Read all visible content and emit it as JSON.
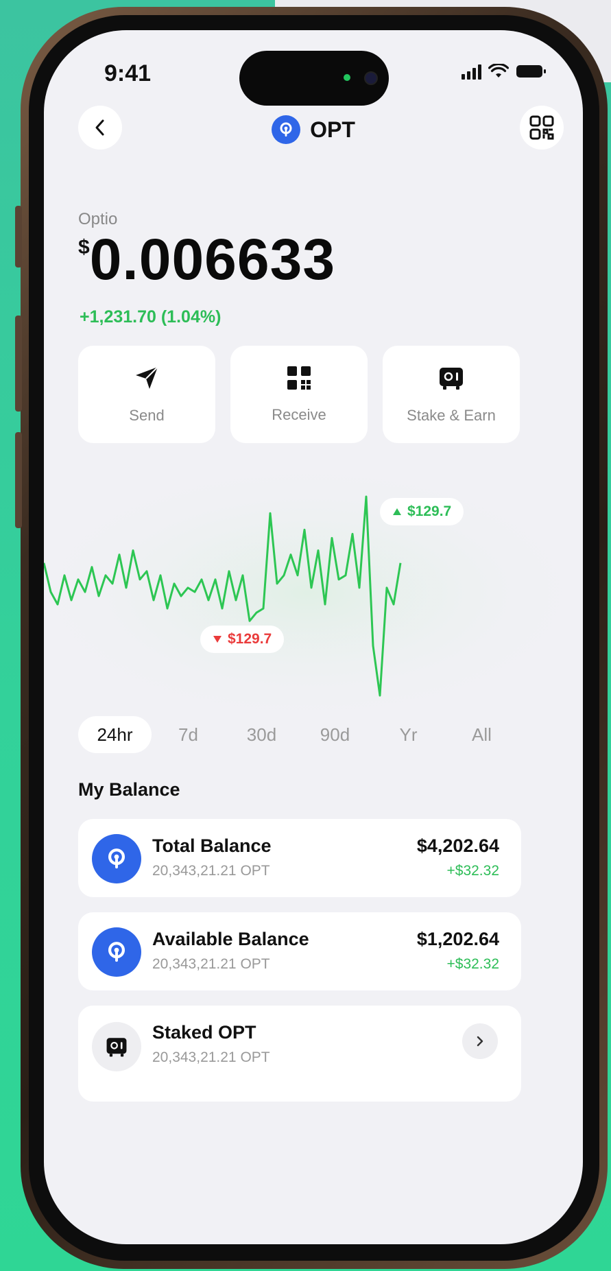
{
  "status_bar": {
    "time": "9:41"
  },
  "header": {
    "title": "OPT"
  },
  "token": {
    "name": "Optio",
    "currency_symbol": "$",
    "price": "0.006633",
    "change": "+1,231.70 (1.04%)"
  },
  "actions": [
    {
      "label": "Send",
      "icon": "send-icon"
    },
    {
      "label": "Receive",
      "icon": "qr-icon"
    },
    {
      "label": "Stake & Earn",
      "icon": "vault-icon"
    }
  ],
  "chart_data": {
    "type": "line",
    "title": "",
    "xlabel": "",
    "ylabel": "",
    "series": [
      {
        "values": [
          130,
          123,
          120,
          127,
          121,
          126,
          123,
          129,
          122,
          127,
          125,
          132,
          124,
          133,
          126,
          128,
          121,
          127,
          119,
          125,
          122,
          124,
          123,
          126,
          121,
          126,
          119,
          128,
          121,
          127,
          116,
          118,
          119,
          142,
          125,
          127,
          132,
          127,
          138,
          124,
          133,
          120,
          136,
          126,
          127,
          137,
          124,
          146,
          110,
          98,
          124,
          120,
          130
        ]
      }
    ],
    "annotations": [
      {
        "label": "$129.7",
        "direction": "up",
        "color": "#2dbd57"
      },
      {
        "label": "$129.7",
        "direction": "down",
        "color": "#ea3b3b"
      }
    ],
    "line_color": "#2dc653"
  },
  "periods": [
    {
      "label": "24hr",
      "active": true
    },
    {
      "label": "7d",
      "active": false
    },
    {
      "label": "30d",
      "active": false
    },
    {
      "label": "90d",
      "active": false
    },
    {
      "label": "Yr",
      "active": false
    },
    {
      "label": "All",
      "active": false
    }
  ],
  "balance": {
    "title": "My Balance",
    "rows": [
      {
        "title": "Total Balance",
        "sub": "20,343,21.21 OPT",
        "amount": "$4,202.64",
        "delta": "+$32.32"
      },
      {
        "title": "Available Balance",
        "sub": "20,343,21.21 OPT",
        "amount": "$1,202.64",
        "delta": "+$32.32"
      },
      {
        "title": "Staked OPT",
        "sub": "20,343,21.21 OPT"
      }
    ]
  },
  "colors": {
    "accent_blue": "#2f66e8",
    "positive": "#2dbd57",
    "negative": "#ea3b3b",
    "background": "#f1f1f5"
  }
}
